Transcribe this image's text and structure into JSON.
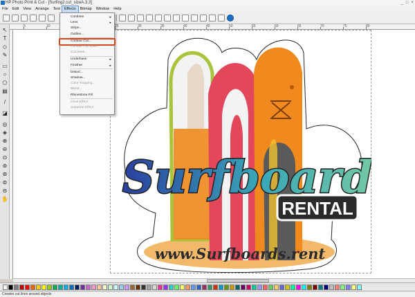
{
  "window": {
    "title": "HP Photo Print & Cut - [Surfing2.cut_sizeA.3.3]",
    "controls": [
      "_",
      "□",
      "×"
    ]
  },
  "menubar": {
    "items": [
      "File",
      "Edit",
      "View",
      "Arrange",
      "Text",
      "Effects",
      "Bitmap",
      "Window",
      "Help"
    ],
    "active": "Effects"
  },
  "effects_menu": {
    "items": [
      {
        "label": "Combine",
        "submenu": true,
        "disabled": false
      },
      {
        "label": "Lens",
        "submenu": true,
        "disabled": false
      },
      {
        "label": "Stripe...",
        "submenu": false,
        "disabled": false
      },
      {
        "label": "Outline...",
        "submenu": false,
        "disabled": false
      },
      {
        "label": "Contour Cut...",
        "submenu": false,
        "disabled": false
      },
      {
        "label": "Contour Cut Mark...",
        "submenu": false,
        "disabled": true
      },
      {
        "label": "iCut Mark...",
        "submenu": false,
        "disabled": true
      },
      {
        "label": "Underbase",
        "submenu": true,
        "disabled": false
      },
      {
        "label": "Finisher",
        "submenu": true,
        "disabled": false
      },
      {
        "label": "Distort...",
        "submenu": false,
        "disabled": false
      },
      {
        "label": "Shadow...",
        "submenu": false,
        "disabled": false
      },
      {
        "label": "Color Trapping...",
        "submenu": false,
        "disabled": true
      },
      {
        "label": "Blend...",
        "submenu": false,
        "disabled": true
      },
      {
        "label": "Rhinestone Fill",
        "submenu": false,
        "disabled": false
      },
      {
        "label": "Clear Effect",
        "submenu": false,
        "disabled": true
      },
      {
        "label": "Separate Effect",
        "submenu": false,
        "disabled": true
      }
    ],
    "highlighted": "Contour Cut..."
  },
  "ruler": {
    "labels": [
      "5",
      "10",
      "15",
      "20",
      "25",
      "30",
      "35",
      "40",
      "45",
      "50",
      "55",
      "60",
      "65",
      "70",
      "75",
      "80"
    ]
  },
  "artwork": {
    "headline": "Surfboards",
    "subheadline": "RENTAL",
    "website": "www.Surfboards.rent"
  },
  "colors": {
    "accent_highlight": "#d9441a",
    "board_green_outline": "#a8c43c",
    "board_red": "#e2475b",
    "board_orange": "#f08a1e",
    "board_gray": "#5a5a5a",
    "headline_gradient_start": "#2a3fa0",
    "headline_gradient_end": "#7fd0a0",
    "ellipse_sand": "#f2b96a"
  },
  "palette": [
    "#ffffff",
    "#000000",
    "#7f7f7f",
    "#c00000",
    "#ff0000",
    "#ff6600",
    "#ffcc00",
    "#ffff00",
    "#99cc00",
    "#00b050",
    "#00b0a0",
    "#00b0f0",
    "#0070c0",
    "#002060",
    "#7030a0",
    "#cc66cc",
    "#ff99cc",
    "#ffcc99",
    "#ffffcc",
    "#ccffcc",
    "#ccffff",
    "#99ccff",
    "#cc99ff",
    "#996633",
    "#663300",
    "#333333",
    "#a6a6a6",
    "#d9d9d9",
    "#ff3399",
    "#9933ff",
    "#33cccc",
    "#66ff66",
    "#ffff66",
    "#ff9966",
    "#6699ff",
    "#3366cc",
    "#993366",
    "#339966",
    "#cc3300",
    "#0099cc",
    "#669900",
    "#cc9900",
    "#006666",
    "#660066",
    "#cc0066",
    "#00cc99",
    "#9999ff",
    "#ff6666",
    "#66cc66",
    "#ffcc66",
    "#6666cc",
    "#cccc00",
    "#00ff99",
    "#ff00ff",
    "#00ffff",
    "#808000",
    "#800000",
    "#008080",
    "#000080",
    "#c0c0c0",
    "#ff8080",
    "#80ff80",
    "#8080ff",
    "#ffff80",
    "#80ffff"
  ],
  "statusbar": {
    "text": "Creates cut lines around objects"
  }
}
